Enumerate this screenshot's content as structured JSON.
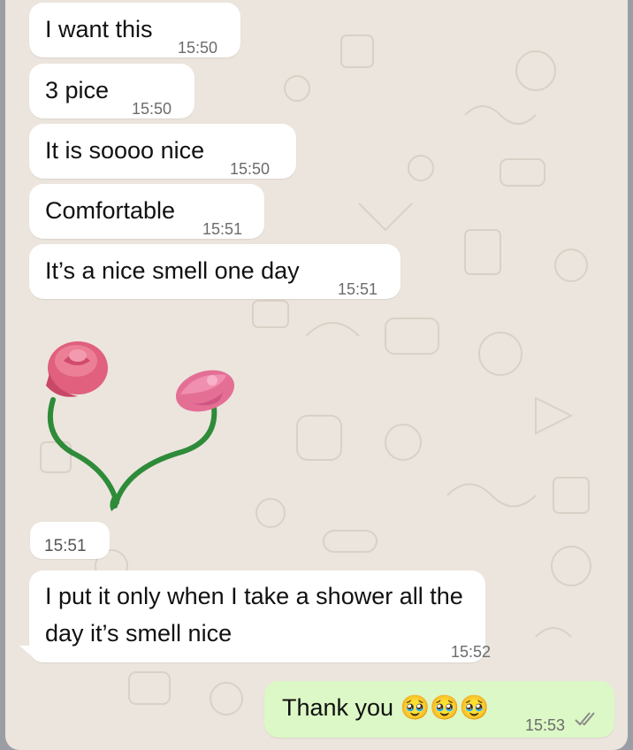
{
  "chat": {
    "messages": [
      {
        "text": "I want this",
        "time": "15:50"
      },
      {
        "text": "3 pice",
        "time": "15:50"
      },
      {
        "text": "It is soooo nice",
        "time": "15:50"
      },
      {
        "text": "Comfortable",
        "time": "15:51"
      },
      {
        "text": "It’s a nice smell one day",
        "time": "15:51"
      },
      {
        "sticker": "rose-sticker",
        "time": "15:51"
      },
      {
        "text": "I put it only when I take a shower all the day it’s smell nice",
        "time": "15:52"
      },
      {
        "text": "Thank you 🥹🥹🥹",
        "time": "15:53",
        "status": "double-check-icon"
      }
    ]
  },
  "colors": {
    "wallpaper": "#ece5dd",
    "incoming_bubble": "#ffffff",
    "outgoing_bubble": "#dcf8c6",
    "time_text": "#6c6c6c"
  }
}
